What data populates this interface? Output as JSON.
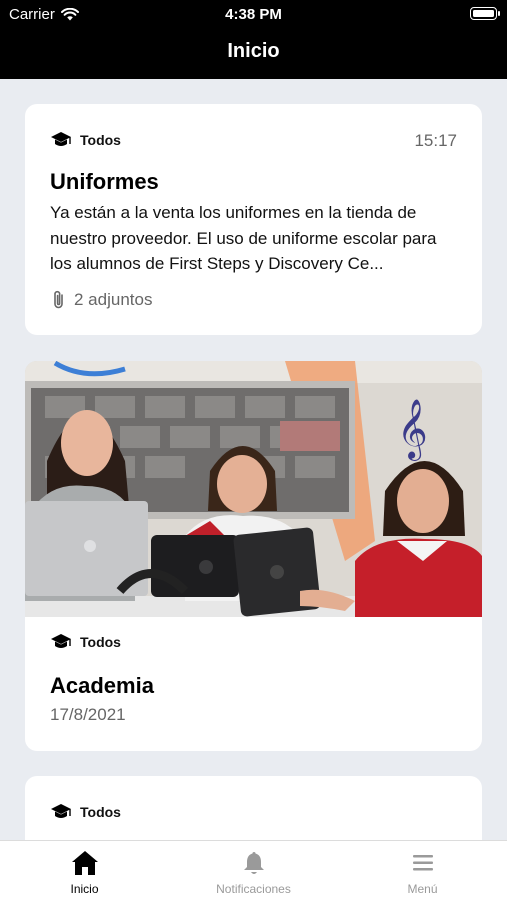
{
  "status_bar": {
    "carrier": "Carrier",
    "time": "4:38 PM"
  },
  "nav": {
    "title": "Inicio"
  },
  "feed": [
    {
      "category": "Todos",
      "time": "15:17",
      "title": "Uniformes",
      "body": "Ya están a la venta los uniformes en la tienda de nuestro proveedor. El uso de uniforme escolar para los alumnos de First Steps y Discovery Ce...",
      "attachments": "2 adjuntos"
    },
    {
      "category": "Todos",
      "image": "students-with-teacher-using-tablets-photo",
      "title": "Academia",
      "date": "17/8/2021"
    },
    {
      "category": "Todos"
    }
  ],
  "tabbar": {
    "items": [
      {
        "label": "Inicio",
        "icon": "home-icon",
        "active": true
      },
      {
        "label": "Notificaciones",
        "icon": "bell-icon",
        "active": false
      },
      {
        "label": "Menú",
        "icon": "hamburger-menu-icon",
        "active": false
      }
    ]
  },
  "colors": {
    "topbar_bg": "#000000",
    "feed_bg": "#e9ecf1",
    "card_bg": "#ffffff",
    "secondary_text": "#666666",
    "tab_active": "#000000",
    "tab_inactive": "#9a9a9a"
  }
}
